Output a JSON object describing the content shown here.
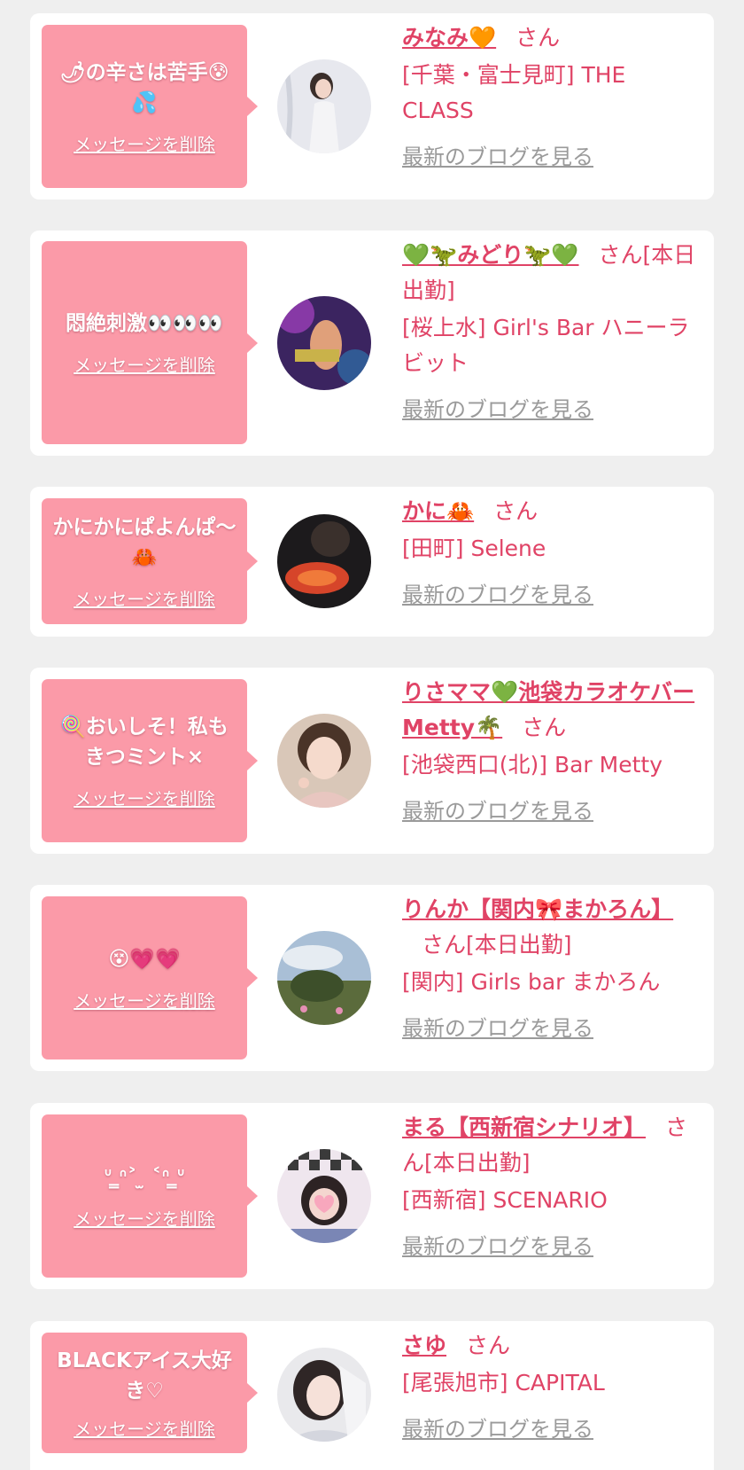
{
  "delete_label": "メッセージを削除",
  "blog_label": "最新のブログを見る",
  "honorific": "さん",
  "colors": {
    "bubble": "#fb9aa8",
    "accent": "#e04366",
    "link_gray": "#9a9a9a",
    "background": "#efefef"
  },
  "messages": [
    {
      "message": "🌶の辛さは苦手😰💦",
      "name": "みなみ🧡",
      "name_suffix": "",
      "shop": "[千葉・富士見町] THE CLASS",
      "avatar_icon": "avatar-photo"
    },
    {
      "message": "悶絶刺激👀👀👀",
      "name": "💚🦖みどり🦖💚",
      "name_suffix": "[本日出勤]",
      "shop": "[桜上水] Girl's Bar ハニーラビット",
      "avatar_icon": "avatar-photo"
    },
    {
      "message": "かにかにぱよんぱ〜🦀",
      "name": "かに🦀",
      "name_suffix": "",
      "shop": "[田町] Selene",
      "avatar_icon": "avatar-photo"
    },
    {
      "message": "🍭おいしそ！私もきつミント×",
      "name": "りさママ💚池袋カラオケバーMetty🌴",
      "name_suffix": "",
      "shop": "[池袋西口(北)] Bar Metty",
      "avatar_icon": "avatar-photo"
    },
    {
      "message": "😵💗💗",
      "name": "りんか【関内🎀まかろん】",
      "name_suffix": "[本日出勤]",
      "shop": "[関内] Girls bar まかろん",
      "avatar_icon": "avatar-photo"
    },
    {
      "message": "ᐡ ̳ᐢ˃ ̫ ˂ᐢ ̳ᐡ",
      "name": "まる【西新宿シナリオ】",
      "name_suffix": "[本日出勤]",
      "shop": "[西新宿] SCENARIO",
      "avatar_icon": "avatar-photo"
    },
    {
      "message": "BLACKアイス大好き♡",
      "name": "さゆ",
      "name_suffix": "",
      "shop": "[尾張旭市] CAPITAL",
      "avatar_icon": "avatar-photo"
    }
  ]
}
